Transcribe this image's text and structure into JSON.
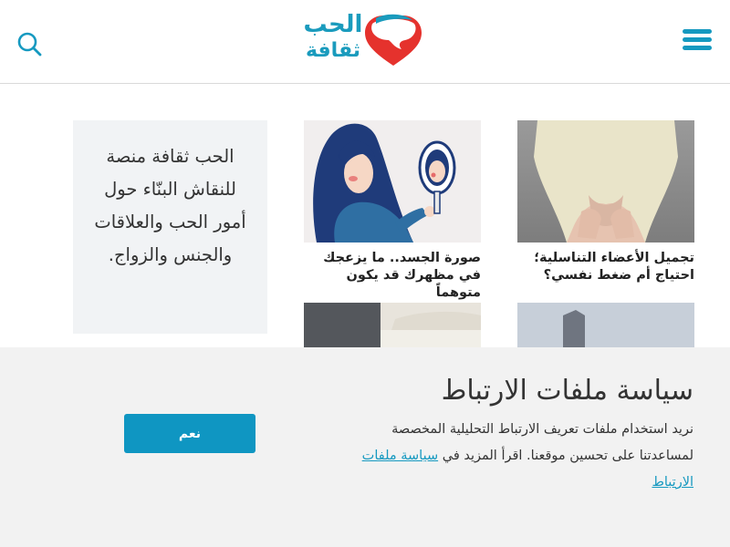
{
  "header": {
    "logo_line1": "الحب",
    "logo_line2": "ثقافة",
    "menu_icon": "hamburger-menu-icon",
    "search_icon": "search-icon"
  },
  "about": {
    "text": "الحب ثقافة منصة للنقاش البنّاء حول أمور الحب والعلاقات والجنس والزواج."
  },
  "articles": [
    {
      "title": "تجميل الأعضاء التناسلية؛ احتياج أم ضغط نفسي؟"
    },
    {
      "title": "صورة الجسد.. ما يزعجك في مظهرك قد يكون متوهماً"
    }
  ],
  "cookie": {
    "title": "سياسة ملفات الارتباط",
    "body": "نريد استخدام ملفات تعريف الارتباط التحليلية المخصصة لمساعدتنا على تحسين موقعنا. اقرأ المزيد في",
    "link_label": "سياسة ملفات الارتباط",
    "accept_label": "نعم"
  },
  "colors": {
    "brand_blue": "#1599c0",
    "brand_red": "#e5322d",
    "banner_bg": "#f2f2f2"
  }
}
